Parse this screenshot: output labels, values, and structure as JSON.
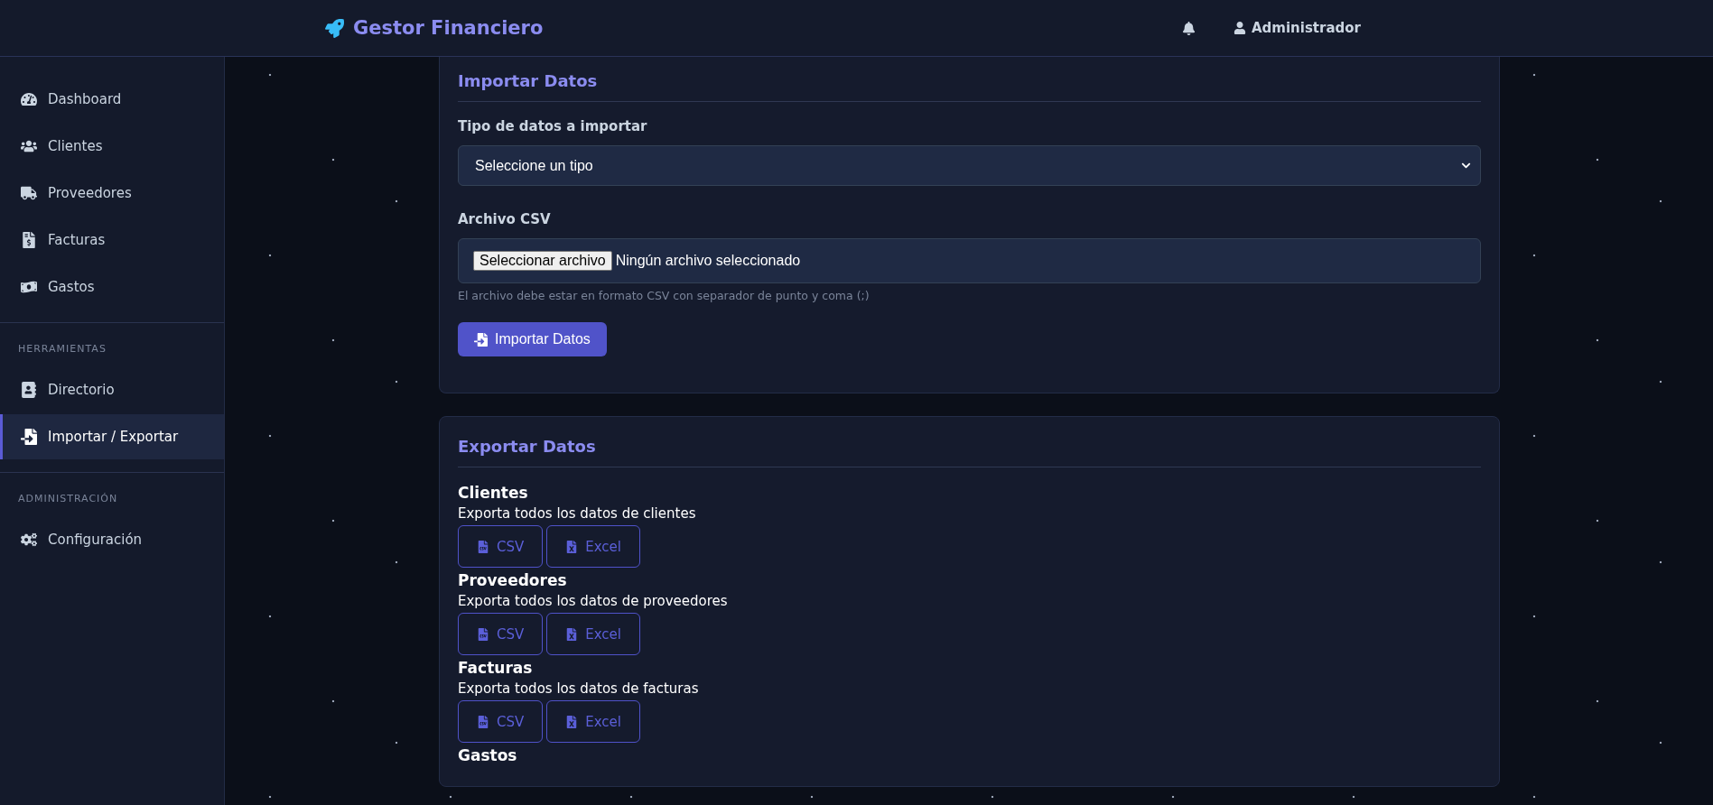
{
  "topbar": {
    "brand": "Gestor Financiero",
    "user": "Administrador"
  },
  "sidebar": {
    "sections": [
      {
        "items": [
          {
            "label": "Dashboard",
            "selected": false
          },
          {
            "label": "Clientes",
            "selected": false
          },
          {
            "label": "Proveedores",
            "selected": false
          },
          {
            "label": "Facturas",
            "selected": false
          },
          {
            "label": "Gastos",
            "selected": false
          }
        ]
      },
      {
        "heading": "HERRAMIENTAS",
        "items": [
          {
            "label": "Directorio",
            "selected": false
          },
          {
            "label": "Importar / Exportar",
            "selected": true
          }
        ]
      },
      {
        "heading": "ADMINISTRACIÓN",
        "items": [
          {
            "label": "Configuración",
            "selected": false
          }
        ]
      }
    ]
  },
  "import_card": {
    "title": "Importar Datos",
    "type_label": "Tipo de datos a importar",
    "type_select": {
      "value": "Seleccione un tipo"
    },
    "file_label": "Archivo CSV",
    "file_input": {
      "button": "Seleccionar archivo",
      "status": "Ningún archivo seleccionado"
    },
    "hint": "El archivo debe estar en formato CSV con separador de punto y coma (;)",
    "submit": "Importar Datos"
  },
  "export_card": {
    "title": "Exportar Datos",
    "groups": [
      {
        "title": "Clientes",
        "description": "Exporta todos los datos de clientes",
        "buttons": [
          {
            "label": "CSV",
            "kind": "csv"
          },
          {
            "label": "Excel",
            "kind": "excel"
          }
        ]
      },
      {
        "title": "Proveedores",
        "description": "Exporta todos los datos de proveedores",
        "buttons": [
          {
            "label": "CSV",
            "kind": "csv"
          },
          {
            "label": "Excel",
            "kind": "excel"
          }
        ]
      },
      {
        "title": "Facturas",
        "description": "Exporta todos los datos de facturas",
        "buttons": [
          {
            "label": "CSV",
            "kind": "csv"
          },
          {
            "label": "Excel",
            "kind": "excel"
          }
        ]
      },
      {
        "title": "Gastos"
      }
    ]
  }
}
